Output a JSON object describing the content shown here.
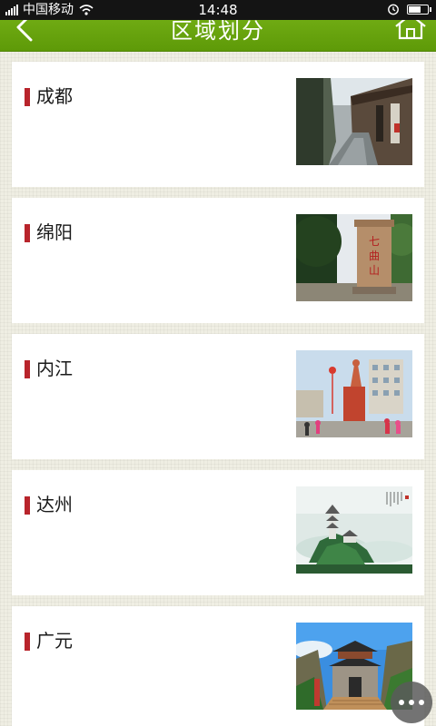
{
  "status_bar": {
    "carrier": "中国移动",
    "time": "14:48"
  },
  "header": {
    "title": "区域划分",
    "back_icon": "back-arrow-icon",
    "home_icon": "home-icon",
    "bar_color": "#6aa710"
  },
  "regions": [
    {
      "label": "成都",
      "image": "old-street-photo"
    },
    {
      "label": "绵阳",
      "image": "stone-monument-photo"
    },
    {
      "label": "内江",
      "image": "statue-plaza-photo"
    },
    {
      "label": "达州",
      "image": "pagoda-mountain-painting"
    },
    {
      "label": "广元",
      "image": "city-gate-photo"
    }
  ],
  "accent_color": "#b8242b",
  "floating_button_icon": "more-dots-icon"
}
